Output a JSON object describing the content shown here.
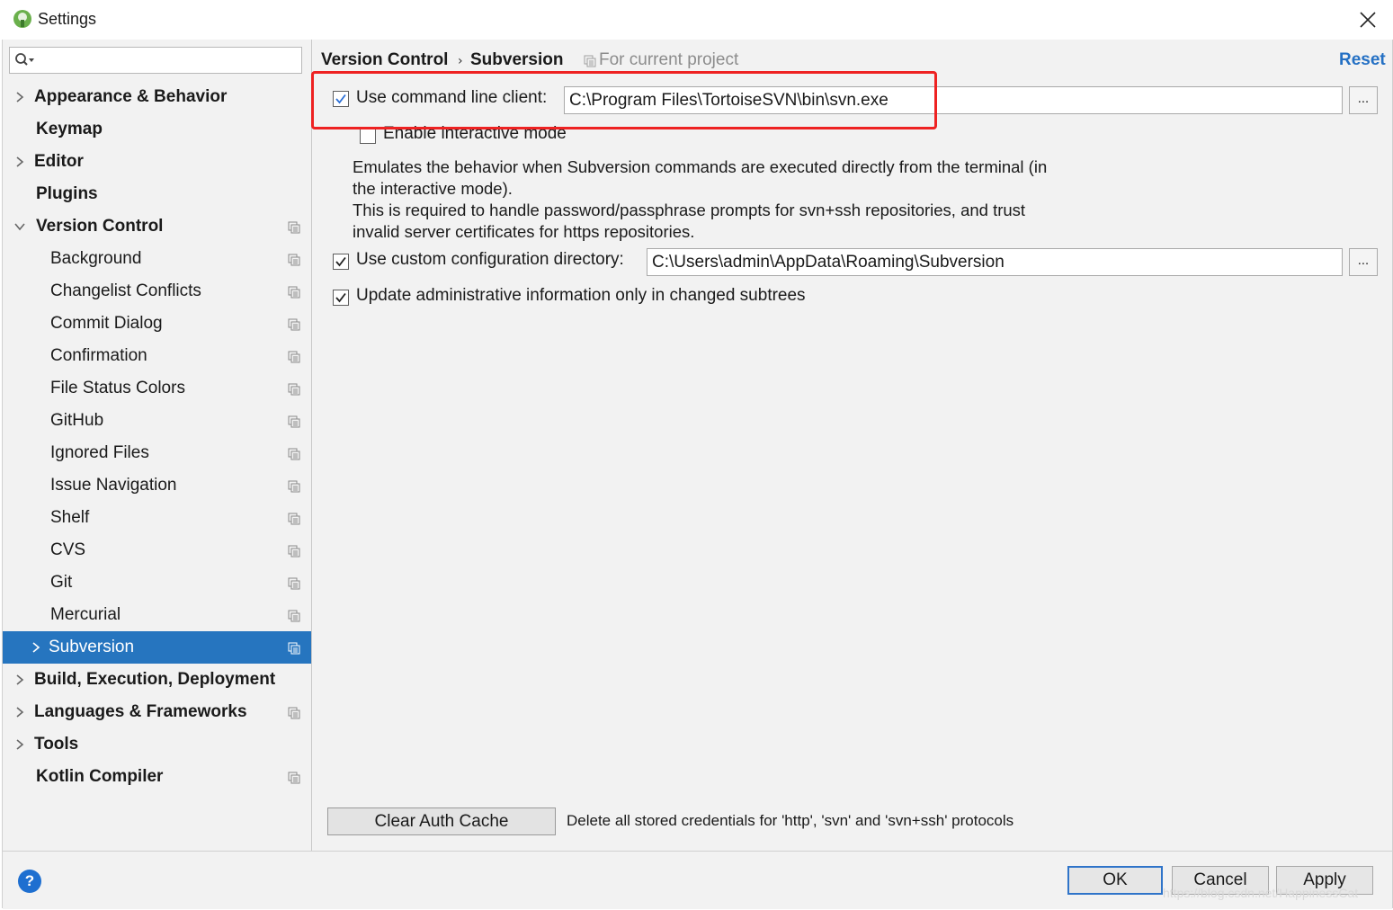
{
  "window": {
    "title": "Settings"
  },
  "search": {
    "placeholder": ""
  },
  "sidebar": {
    "items": [
      {
        "label": "Appearance & Behavior"
      },
      {
        "label": "Keymap"
      },
      {
        "label": "Editor"
      },
      {
        "label": "Plugins"
      },
      {
        "label": "Version Control"
      },
      {
        "label": "Background"
      },
      {
        "label": "Changelist Conflicts"
      },
      {
        "label": "Commit Dialog"
      },
      {
        "label": "Confirmation"
      },
      {
        "label": "File Status Colors"
      },
      {
        "label": "GitHub"
      },
      {
        "label": "Ignored Files"
      },
      {
        "label": "Issue Navigation"
      },
      {
        "label": "Shelf"
      },
      {
        "label": "CVS"
      },
      {
        "label": "Git"
      },
      {
        "label": "Mercurial"
      },
      {
        "label": "Subversion"
      },
      {
        "label": "Build, Execution, Deployment"
      },
      {
        "label": "Languages & Frameworks"
      },
      {
        "label": "Tools"
      },
      {
        "label": "Kotlin Compiler"
      }
    ]
  },
  "breadcrumb": {
    "parent": "Version Control",
    "current": "Subversion",
    "scope": "For current project",
    "reset": "Reset"
  },
  "settings": {
    "use_cmd_client": {
      "label": "Use command line client:",
      "checked": true,
      "value": "C:\\Program Files\\TortoiseSVN\\bin\\svn.exe"
    },
    "interactive_mode": {
      "label": "Enable interactive mode",
      "checked": false
    },
    "description": {
      "line1": "Emulates the behavior when Subversion commands are executed directly from the terminal (in",
      "line2": "the interactive mode).",
      "line3": "This is required to handle password/passphrase prompts for svn+ssh repositories, and trust",
      "line4": "invalid server certificates for https repositories."
    },
    "custom_config_dir": {
      "label": "Use custom configuration directory:",
      "checked": true,
      "value": "C:\\Users\\admin\\AppData\\Roaming\\Subversion"
    },
    "update_admin_info": {
      "label": "Update administrative information only in changed subtrees",
      "checked": true
    },
    "browse_label": "..."
  },
  "auth": {
    "clear_button": "Clear Auth Cache",
    "description": "Delete all stored credentials for 'http', 'svn' and 'svn+ssh' protocols"
  },
  "buttons": {
    "ok": "OK",
    "cancel": "Cancel",
    "apply": "Apply"
  },
  "help": {
    "glyph": "?"
  },
  "watermark": "https://blog.csdn.net/HappinessCat",
  "colors": {
    "selection": "#2675bf",
    "link": "#2470c4",
    "highlight_box": "#ee2222"
  }
}
